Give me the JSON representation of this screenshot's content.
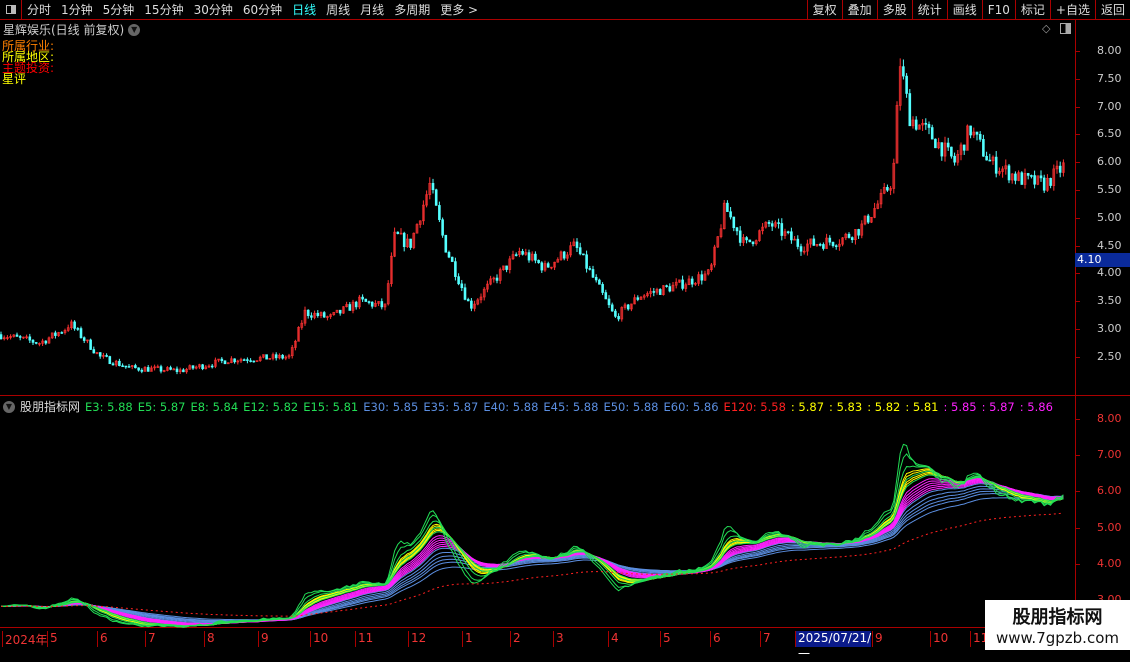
{
  "toolbar": {
    "periods": [
      "分时",
      "1分钟",
      "5分钟",
      "15分钟",
      "30分钟",
      "60分钟",
      "日线",
      "周线",
      "月线",
      "多周期",
      "更多 >"
    ],
    "active": "日线",
    "right_buttons": [
      "复权",
      "叠加",
      "多股",
      "统计",
      "画线",
      "F10",
      "标记",
      "+自选",
      "返回"
    ]
  },
  "main": {
    "title": "星辉娱乐(日线 前复权)",
    "info": [
      {
        "text": "所属行业:",
        "color": "#ff8000"
      },
      {
        "text": "所属地区:",
        "color": "#ffff00"
      },
      {
        "text": "主题投资:",
        "color": "#ff0000"
      },
      {
        "text": "星评",
        "color": "#ffff00"
      }
    ],
    "yticks": [
      "8.00",
      "7.50",
      "7.00",
      "6.50",
      "6.00",
      "5.50",
      "5.00",
      "4.50",
      "4.00",
      "3.50",
      "3.00",
      "2.50"
    ],
    "price_tag": "4.10"
  },
  "indicator": {
    "name": "股朋指标网",
    "values": [
      {
        "t": "E3: 5.88",
        "c": "#22dd55"
      },
      {
        "t": "E5: 5.87",
        "c": "#22dd55"
      },
      {
        "t": "E8: 5.84",
        "c": "#22dd55"
      },
      {
        "t": "E12: 5.82",
        "c": "#22dd55"
      },
      {
        "t": "E15: 5.81",
        "c": "#22dd55"
      },
      {
        "t": "E30: 5.85",
        "c": "#5b8ee0"
      },
      {
        "t": "E35: 5.87",
        "c": "#5b8ee0"
      },
      {
        "t": "E40: 5.88",
        "c": "#5b8ee0"
      },
      {
        "t": "E45: 5.88",
        "c": "#5b8ee0"
      },
      {
        "t": "E50: 5.88",
        "c": "#5b8ee0"
      },
      {
        "t": "E60: 5.86",
        "c": "#5b8ee0"
      },
      {
        "t": "E120: 5.58",
        "c": "#ff2020"
      },
      {
        "t": ": 5.87",
        "c": "#ffff00"
      },
      {
        "t": ": 5.83",
        "c": "#ffff00"
      },
      {
        "t": ": 5.82",
        "c": "#ffff00"
      },
      {
        "t": ": 5.81",
        "c": "#ffff00"
      },
      {
        "t": ": 5.85",
        "c": "#ff22ff"
      },
      {
        "t": ": 5.87",
        "c": "#ff22ff"
      },
      {
        "t": ": 5.86",
        "c": "#ff22ff"
      }
    ],
    "yticks": [
      "8.00",
      "7.00",
      "6.00",
      "5.00",
      "4.00",
      "3.00"
    ]
  },
  "xaxis": {
    "labels": [
      "2024年",
      "5",
      "6",
      "7",
      "8",
      "9",
      "10",
      "11",
      "12",
      "1",
      "2",
      "3",
      "4",
      "5",
      "6",
      "7",
      "9",
      "10",
      "11"
    ],
    "cursor_date": "2025/07/21/一"
  },
  "watermark": {
    "line1": "股朋指标网",
    "line2": "www.7gpzb.com"
  },
  "chart_data": {
    "type": "candlestick",
    "ylim_main": [
      2.2,
      8.3
    ],
    "ylim_indicator": [
      2.9,
      8.2
    ],
    "price_path": [
      [
        0,
        2.9
      ],
      [
        40,
        2.75
      ],
      [
        65,
        3.0
      ],
      [
        70,
        3.1
      ],
      [
        100,
        2.5
      ],
      [
        130,
        2.3
      ],
      [
        180,
        2.25
      ],
      [
        230,
        2.45
      ],
      [
        290,
        2.5
      ],
      [
        305,
        3.3
      ],
      [
        330,
        3.2
      ],
      [
        360,
        3.5
      ],
      [
        385,
        3.4
      ],
      [
        395,
        4.7
      ],
      [
        410,
        4.5
      ],
      [
        430,
        5.6
      ],
      [
        445,
        4.5
      ],
      [
        470,
        3.4
      ],
      [
        490,
        3.8
      ],
      [
        520,
        4.4
      ],
      [
        545,
        4.1
      ],
      [
        575,
        4.5
      ],
      [
        600,
        3.7
      ],
      [
        615,
        3.2
      ],
      [
        640,
        3.6
      ],
      [
        680,
        3.8
      ],
      [
        710,
        4.0
      ],
      [
        725,
        5.2
      ],
      [
        745,
        4.5
      ],
      [
        770,
        4.9
      ],
      [
        800,
        4.5
      ],
      [
        840,
        4.6
      ],
      [
        860,
        4.8
      ],
      [
        880,
        5.3
      ],
      [
        893,
        5.7
      ],
      [
        900,
        7.8
      ],
      [
        910,
        6.8
      ],
      [
        930,
        6.5
      ],
      [
        955,
        6.0
      ],
      [
        970,
        6.6
      ],
      [
        990,
        6.0
      ],
      [
        1020,
        5.7
      ],
      [
        1045,
        5.6
      ],
      [
        1065,
        5.95
      ]
    ]
  }
}
